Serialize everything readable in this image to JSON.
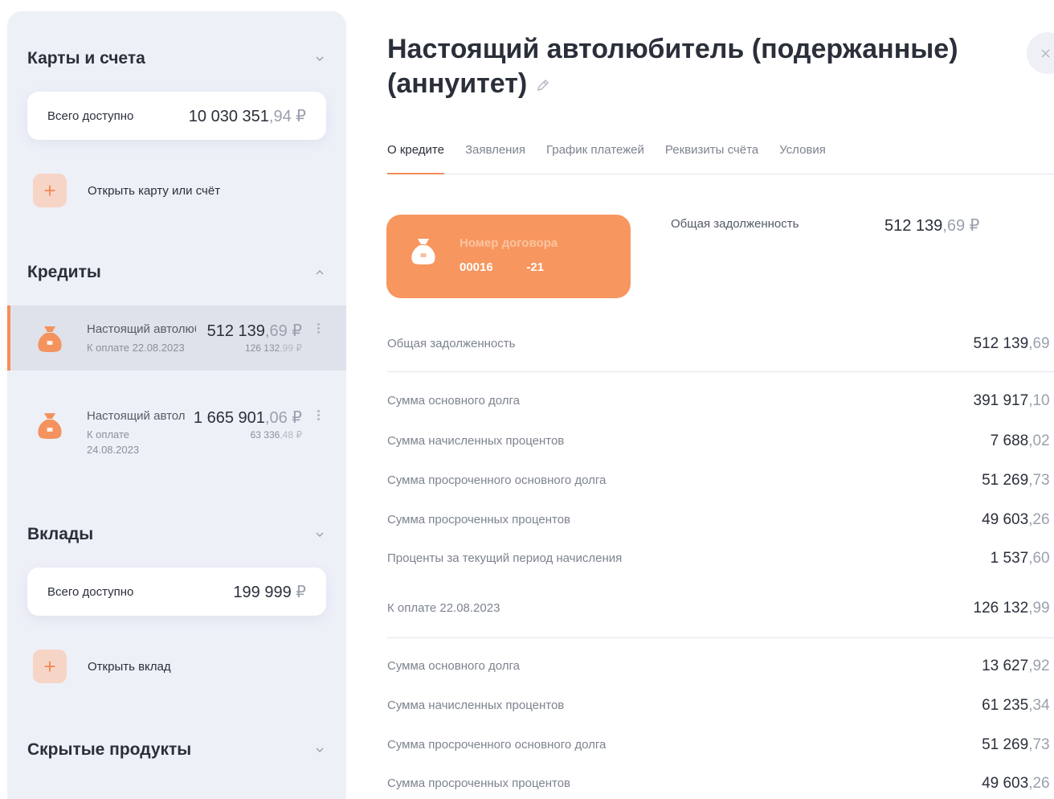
{
  "sidebar": {
    "cards": {
      "title": "Карты и счета",
      "available_label": "Всего доступно",
      "available_rub": "10 030 351",
      "available_kop": ",94",
      "currency": "₽",
      "open_label": "Открыть карту или счёт"
    },
    "loans": {
      "title": "Кредиты",
      "items": [
        {
          "name": "Настоящий автолюбитель",
          "due": "К оплате 22.08.2023",
          "amount_rub": "512 139",
          "amount_kop": ",69",
          "due_rub": "126 132",
          "due_kop": ",99"
        },
        {
          "name": "Настоящий автолюбитель",
          "due_line1": "К оплате",
          "due_line2": "24.08.2023",
          "amount_rub": "1 665 901",
          "amount_kop": ",06",
          "due_rub": "63 336",
          "due_kop": ",48"
        }
      ]
    },
    "deposits": {
      "title": "Вклады",
      "available_label": "Всего доступно",
      "available_rub": "199 999",
      "open_label": "Открыть вклад"
    },
    "hidden": {
      "title": "Скрытые продукты"
    }
  },
  "main": {
    "title": "Настоящий автолюбитель (подержанные) (аннуитет)",
    "tabs": [
      "О кредите",
      "Заявления",
      "График платежей",
      "Реквизиты счёта",
      "Условия"
    ],
    "active_tab": "О кредите",
    "contract": {
      "label": "Номер договора",
      "number": "00016          -21"
    },
    "total_debt_label": "Общая задолженность",
    "total_debt_rub": "512 139",
    "total_debt_kop": ",69",
    "rows": [
      {
        "label": "Общая задолженность",
        "rub": "512 139",
        "kop": ",69"
      },
      {
        "label": "Сумма основного долга",
        "rub": "391 917",
        "kop": ",10"
      },
      {
        "label": "Сумма начисленных процентов",
        "rub": "7 688",
        "kop": ",02"
      },
      {
        "label": "Сумма просроченного основного долга",
        "rub": "51 269",
        "kop": ",73"
      },
      {
        "label": "Сумма просроченных процентов",
        "rub": "49 603",
        "kop": ",26"
      },
      {
        "label": "Проценты за текущий период начисления",
        "rub": "1 537",
        "kop": ",60"
      },
      {
        "label": "К оплате 22.08.2023",
        "rub": "126 132",
        "kop": ",99"
      },
      {
        "label": "Сумма основного долга",
        "rub": "13 627",
        "kop": ",92"
      },
      {
        "label": "Сумма начисленных процентов",
        "rub": "61 235",
        "kop": ",34"
      },
      {
        "label": "Сумма просроченного основного долга",
        "rub": "51 269",
        "kop": ",73"
      },
      {
        "label": "Сумма просроченных процентов",
        "rub": "49 603",
        "kop": ",26"
      }
    ]
  },
  "colors": {
    "accent": "#f48d5b",
    "contract_card": "#f7965e",
    "sidebar_bg": "#eef0f8",
    "active_row": "#dfe2ea"
  },
  "icons": [
    "chevron-down-icon",
    "chevron-up-icon",
    "plus-icon",
    "money-bag-icon",
    "kebab-menu-icon",
    "edit-pencil-icon",
    "close-icon"
  ]
}
